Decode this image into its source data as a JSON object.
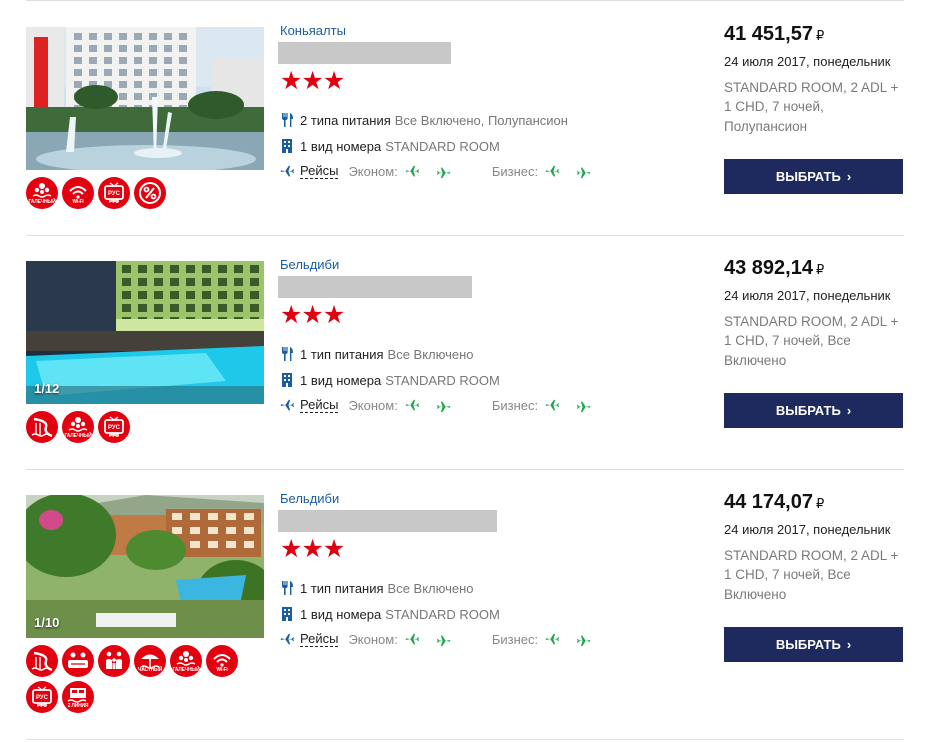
{
  "hotels": [
    {
      "location": "Коньяалты",
      "stars": "★★★",
      "meals_count": "2 типа питания",
      "meals_types": "Все Включено, Полупансион",
      "rooms_count": "1 вид номера",
      "rooms_type": "STANDARD ROOM",
      "flights_label": "Рейсы",
      "economy_label": "Эконом:",
      "business_label": "Бизнес:",
      "price": "41 451,57",
      "currency": "₽",
      "date": "24 июля 2017, понедельник",
      "description": "STANDARD ROOM, 2 ADL + 1 CHD, 7 ночей, Полупансион",
      "button": "ВЫБРАТЬ",
      "photo_counter": "",
      "badges": [
        {
          "icon": "pebble-beach-icon",
          "text": "ГАЛЕЧНЫЙ"
        },
        {
          "icon": "wifi-icon",
          "text": "Wi-Fi"
        },
        {
          "icon": "russian-tv-icon",
          "text": "РУС"
        },
        {
          "icon": "discount-icon",
          "text": ""
        }
      ]
    },
    {
      "location": "Бельдиби",
      "stars": "★★★",
      "meals_count": "1 тип питания",
      "meals_types": "Все Включено",
      "rooms_count": "1 вид номера",
      "rooms_type": "STANDARD ROOM",
      "flights_label": "Рейсы",
      "economy_label": "Эконом:",
      "business_label": "Бизнес:",
      "price": "43 892,14",
      "currency": "₽",
      "date": "24 июля 2017, понедельник",
      "description": "STANDARD ROOM, 2 ADL + 1 CHD, 7 ночей, Все Включено",
      "button": "ВЫБРАТЬ",
      "photo_counter": "1/12",
      "badges": [
        {
          "icon": "water-slide-icon",
          "text": ""
        },
        {
          "icon": "pebble-beach-icon",
          "text": "ГАЛЕЧНЫЙ"
        },
        {
          "icon": "russian-tv-icon",
          "text": "РУС"
        }
      ]
    },
    {
      "location": "Бельдиби",
      "stars": "★★★",
      "meals_count": "1 тип питания",
      "meals_types": "Все Включено",
      "rooms_count": "1 вид номера",
      "rooms_type": "STANDARD ROOM",
      "flights_label": "Рейсы",
      "economy_label": "Эконом:",
      "business_label": "Бизнес:",
      "price": "44 174,07",
      "currency": "₽",
      "date": "24 июля 2017, понедельник",
      "description": "STANDARD ROOM, 2 ADL + 1 CHD, 7 ночей, Все Включено",
      "button": "ВЫБРАТЬ",
      "photo_counter": "1/10",
      "badges": [
        {
          "icon": "water-slide-icon",
          "text": ""
        },
        {
          "icon": "kids-club-icon",
          "text": ""
        },
        {
          "icon": "family-icon",
          "text": ""
        },
        {
          "icon": "private-beach-icon",
          "text": "ЧАСТНЫЙ"
        },
        {
          "icon": "pebble-beach-icon",
          "text": "ГАЛЕЧНЫЙ"
        },
        {
          "icon": "wifi-icon",
          "text": "Wi-Fi"
        },
        {
          "icon": "russian-tv-icon",
          "text": "РУС"
        },
        {
          "icon": "beach-line-icon",
          "text": "2 ЛИНИЯ"
        }
      ]
    }
  ],
  "colors": {
    "accent_red": "#e3000f",
    "button_navy": "#1e2a5e",
    "link_blue": "#1a5da0",
    "flight_green": "#1fa64a",
    "flight_blue": "#1a5da0"
  }
}
